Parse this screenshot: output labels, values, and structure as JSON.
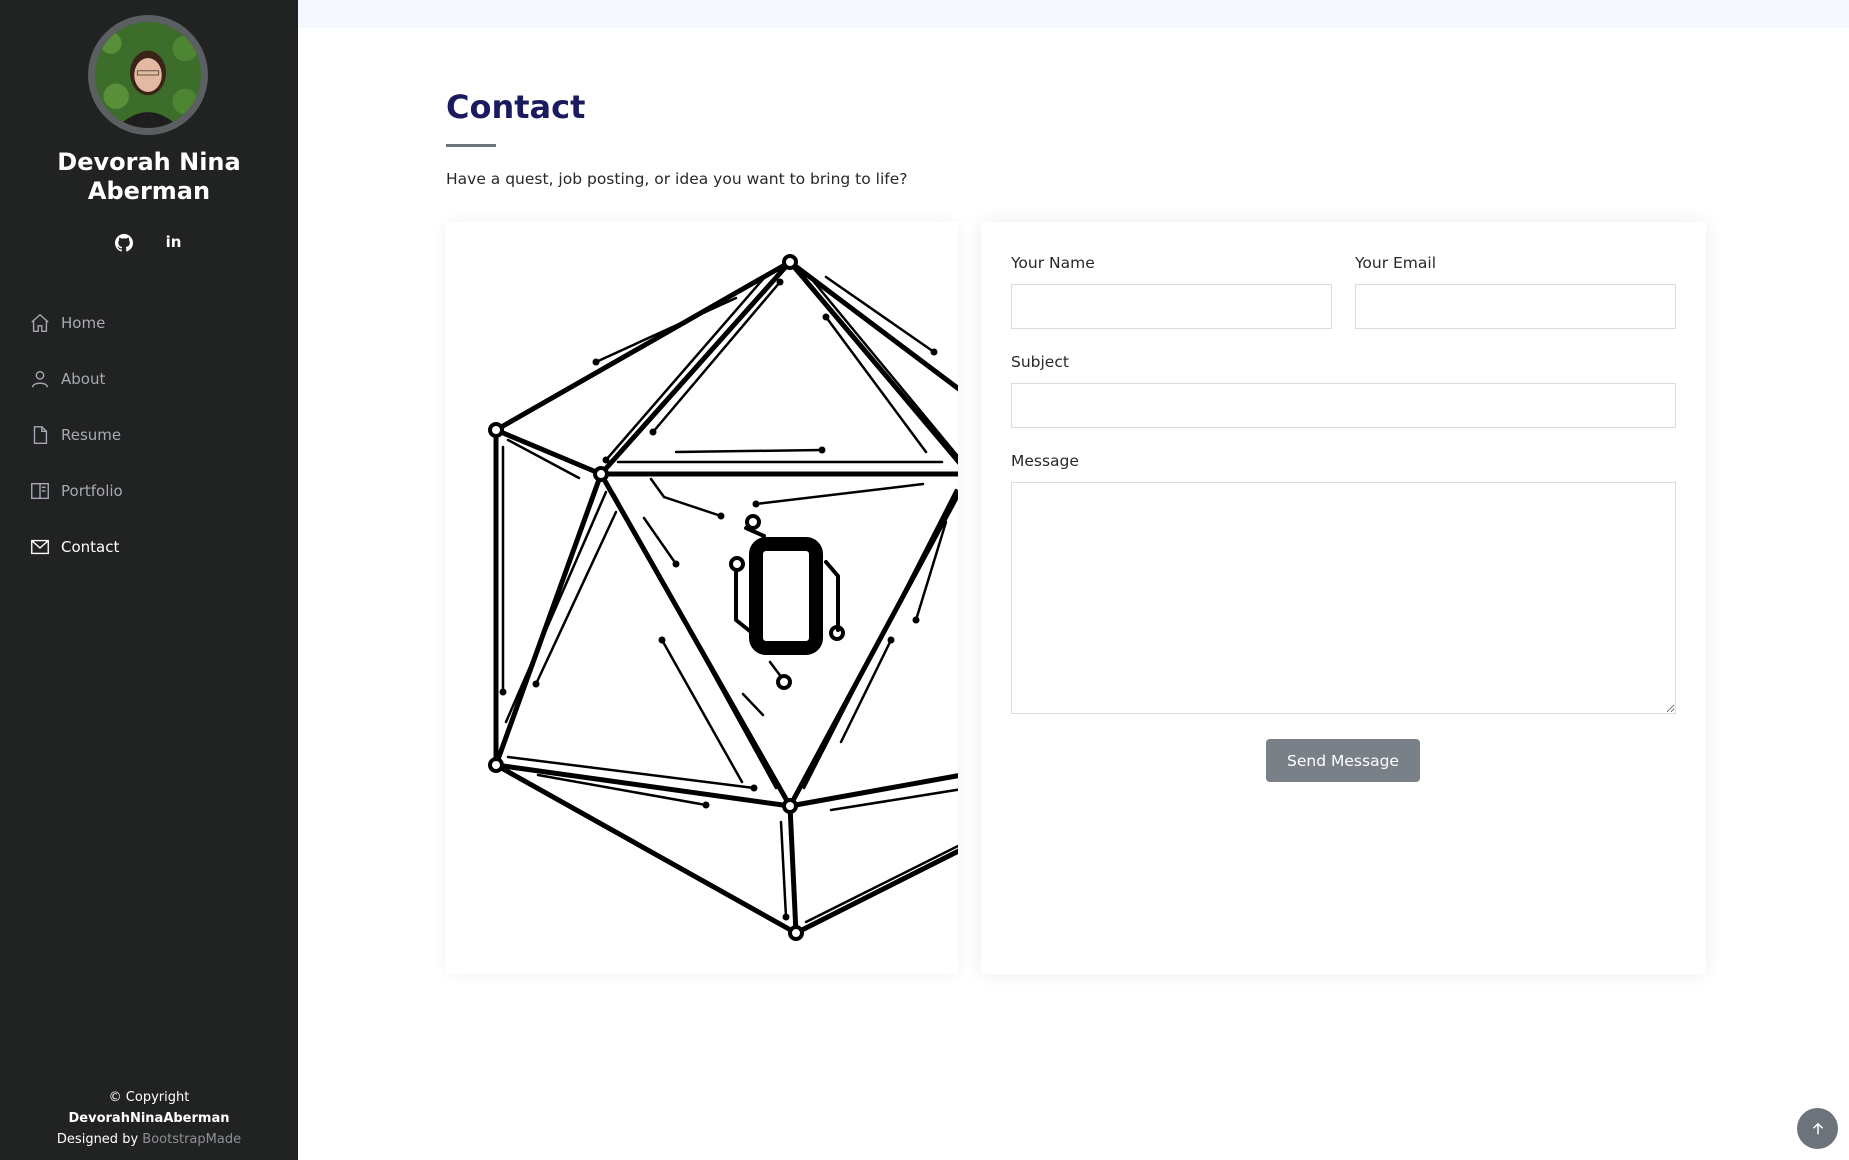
{
  "sidebar": {
    "name": "Devorah Nina Aberman",
    "social": [
      {
        "icon": "github-icon"
      },
      {
        "icon": "linkedin-icon",
        "text": "in"
      }
    ],
    "nav": [
      {
        "label": "Home",
        "icon": "home-icon",
        "active": false
      },
      {
        "label": "About",
        "icon": "person-icon",
        "active": false
      },
      {
        "label": "Resume",
        "icon": "file-icon",
        "active": false
      },
      {
        "label": "Portfolio",
        "icon": "portfolio-icon",
        "active": false
      },
      {
        "label": "Contact",
        "icon": "envelope-icon",
        "active": true
      }
    ],
    "footer": {
      "copyright": "© Copyright",
      "owner": "DevorahNinaAberman",
      "designed_by_prefix": "Designed by",
      "designed_by": "BootstrapMade"
    }
  },
  "contact": {
    "title": "Contact",
    "description": "Have a quest, job posting, or idea you want to bring to life?",
    "form": {
      "name_label": "Your Name",
      "name_value": "",
      "email_label": "Your Email",
      "email_value": "",
      "subject_label": "Subject",
      "subject_value": "",
      "message_label": "Message",
      "message_value": "",
      "submit_label": "Send Message"
    }
  },
  "colors": {
    "sidebar_bg": "#212222",
    "title": "#1a1b5f",
    "button": "#7a8087"
  }
}
